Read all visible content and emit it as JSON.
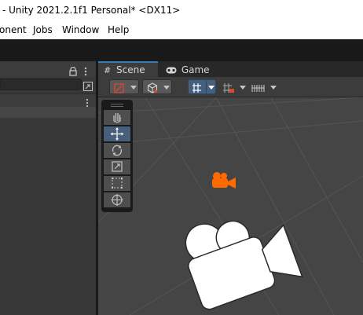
{
  "window": {
    "title": "- Unity 2021.2.1f1 Personal* <DX11>"
  },
  "menu": {
    "items": [
      "onent",
      "Jobs",
      "Window",
      "Help"
    ]
  },
  "tabs": [
    {
      "label": "Scene"
    },
    {
      "label": "Game"
    }
  ],
  "left_panel": {
    "lock_icon": "lock-icon",
    "menu_icon": "kebab-menu-icon"
  },
  "scene_toolbar": {
    "buttons": [
      "draw-mode-icon",
      "shading-icon",
      "gizmo-2d-3d-icon",
      "grid-snap-icon",
      "increment-snap-icon"
    ]
  },
  "tools": [
    {
      "name": "hand-tool",
      "icon": "hand-icon"
    },
    {
      "name": "move-tool",
      "icon": "move-arrows-icon",
      "selected": true
    },
    {
      "name": "rotate-tool",
      "icon": "rotate-icon"
    },
    {
      "name": "scale-tool",
      "icon": "scale-icon"
    },
    {
      "name": "rect-tool",
      "icon": "rect-icon"
    },
    {
      "name": "transform-tool",
      "icon": "transform-icon"
    }
  ],
  "colors": {
    "selected_blue": "#46607c",
    "tab_accent": "#3a79bb",
    "orange_camera": "#ff6a00",
    "gizmo_white": "#ffffff"
  }
}
